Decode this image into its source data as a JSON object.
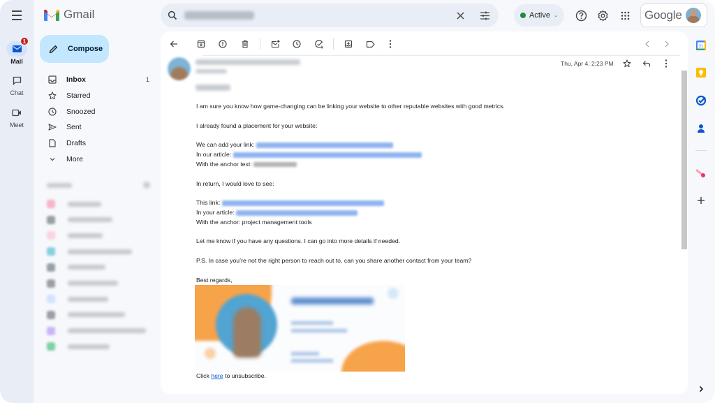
{
  "rail": {
    "items": [
      {
        "label": "Mail",
        "icon": "mail-icon",
        "badge": "1",
        "active": true
      },
      {
        "label": "Chat",
        "icon": "chat-icon"
      },
      {
        "label": "Meet",
        "icon": "video-icon"
      }
    ]
  },
  "app": {
    "name": "Gmail"
  },
  "compose": {
    "label": "Compose"
  },
  "nav": {
    "items": [
      {
        "label": "Inbox",
        "count": "1",
        "icon": "inbox-icon"
      },
      {
        "label": "Starred",
        "icon": "star-icon"
      },
      {
        "label": "Snoozed",
        "icon": "clock-icon"
      },
      {
        "label": "Sent",
        "icon": "send-icon"
      },
      {
        "label": "Drafts",
        "icon": "draft-icon"
      },
      {
        "label": "More",
        "icon": "chevron-down-icon"
      }
    ]
  },
  "labels": {
    "colors": [
      "#f4b6c8",
      "#9aa0a6",
      "#fbd3df",
      "#89cfe0",
      "#9aa0a6",
      "#9aa0a6",
      "#d2e3fc",
      "#9aa0a6",
      "#c8b6f6",
      "#7fd1a3"
    ]
  },
  "search": {
    "query": "[blurred]"
  },
  "status": {
    "label": "Active",
    "color": "#1e8e3e"
  },
  "brand": {
    "word": "Google"
  },
  "email": {
    "date": "Thu, Apr 4, 2:23 PM",
    "lines": {
      "p1": "I am sure you know how game-changing can be linking your website to other reputable websites with good metrics.",
      "p2": "I already found a placement for your website:",
      "add_link": "We can add your link:",
      "our_article": "In our article:",
      "anchor_text": "With the anchor text:",
      "in_return": "In return, I would love to see:",
      "this_link": "This link:",
      "your_article": "In your article:",
      "anchor": "With the anchor: project management tools",
      "questions": "Let me know if you have any questions. I can go into more details if needed.",
      "ps": "P.S. In case you’re not the right person to reach out to, can you share another contact from your team?",
      "regards": "Best regards,",
      "click": "Click",
      "here": "here",
      "unsub": "to unsubscribe."
    }
  }
}
